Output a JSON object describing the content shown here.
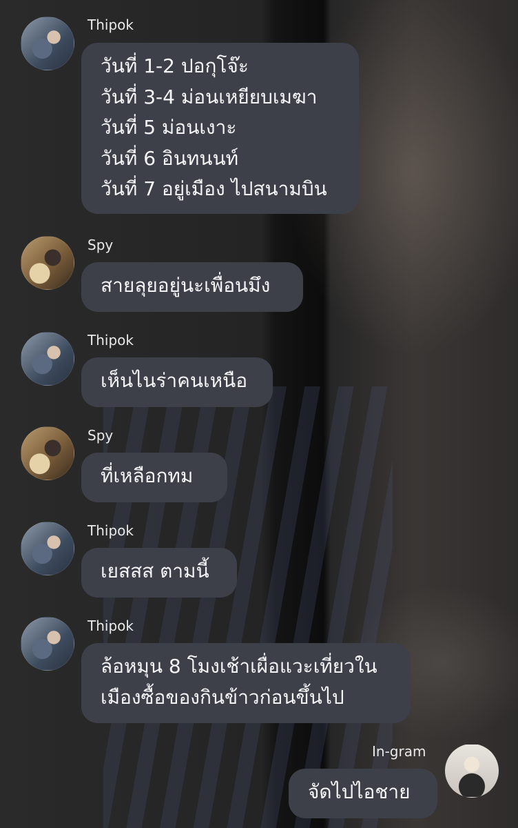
{
  "messages": [
    {
      "sender": "Thipok",
      "avatar": "thipok-avatar",
      "text": "วันที่ 1-2 ปอกุโจ๊ะ\nวันที่ 3-4 ม่อนเหยียบเมฆา\nวันที่ 5 ม่อนเงาะ\nวันที่ 6 อินทนนท์\nวันที่ 7 อยู่เมือง ไปสนามบิน"
    },
    {
      "sender": "Spy",
      "avatar": "spy-avatar",
      "text": "สายลุยอยู่นะเพื่อนมึง"
    },
    {
      "sender": "Thipok",
      "avatar": "thipok-avatar",
      "text": "เห็นไนร่าคนเหนือ"
    },
    {
      "sender": "Spy",
      "avatar": "spy-avatar",
      "text": "ที่เหลือกทม"
    },
    {
      "sender": "Thipok",
      "avatar": "thipok-avatar",
      "text": "เยสสส ตามนี้"
    },
    {
      "sender": "Thipok",
      "avatar": "thipok-avatar",
      "text": "ล้อหมุน 8 โมงเช้าเผื่อแวะเที่ยวใน\nเมืองซื้อของกินข้าวก่อนขึ้นไป"
    },
    {
      "sender": "In-gram",
      "avatar": "self-avatar",
      "text": "จัดไปไอชาย"
    }
  ]
}
